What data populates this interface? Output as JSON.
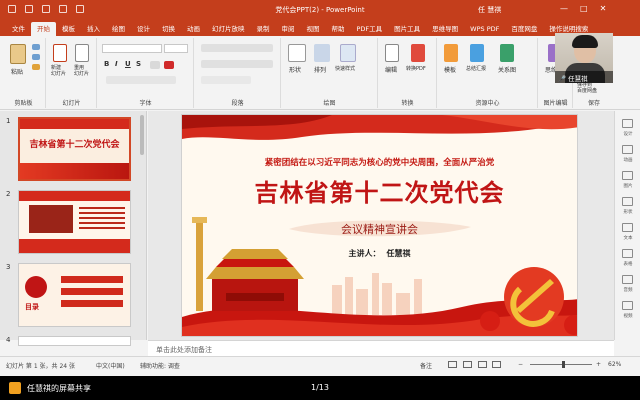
{
  "titlebar": {
    "title": "党代会PPT(2)  -  PowerPoint",
    "user_name": "任 慧祺",
    "min_icon": "minimize-icon",
    "max_icon": "maximize-icon",
    "close_icon": "close-icon"
  },
  "ribbon_tabs": [
    "文件",
    "开始",
    "模板",
    "插入",
    "绘图",
    "设计",
    "切换",
    "动画",
    "幻灯片放映",
    "录制",
    "审阅",
    "视图",
    "帮助",
    "PDF工具",
    "图片工具",
    "思维导图",
    "WPS PDF",
    "百度网盘",
    "操作说明搜索"
  ],
  "active_tab": "开始",
  "ribbon": {
    "paste_label": "粘贴",
    "new_slide_label": "新建\n幻灯片",
    "reuse_label": "重用\n幻灯片",
    "shapes_label": "形状",
    "arrange_label": "排列",
    "quick_styles_label": "快速样式",
    "edit_label": "编辑",
    "to_pdf_label": "转换PDF",
    "template_label": "模板",
    "summary_label": "总结汇报",
    "relation_label": "关系图",
    "mindmap_label": "思维导",
    "baidu_save_label": "保存到\n百度网盘",
    "groups": {
      "clipboard": "剪贴板",
      "slides": "幻灯片",
      "font": "字体",
      "paragraph": "段落",
      "drawing": "绘图",
      "convert": "转换",
      "resource": "资源中心",
      "image_edit": "图片编辑",
      "save": "保存"
    }
  },
  "thumbnails": [
    {
      "num": "1",
      "title": "吉林省第十二次党代会",
      "selected": true
    },
    {
      "num": "2",
      "title": "",
      "selected": false
    },
    {
      "num": "3",
      "title": "目录",
      "selected": false
    },
    {
      "num": "4",
      "title": "",
      "selected": false
    }
  ],
  "slide": {
    "subtitle": "紧密团结在以习近平同志为核心的党中央周围，全面从严治党",
    "title": "吉林省第十二次党代会",
    "caption": "会议精神宣讲会",
    "speaker_label": "主讲人：",
    "speaker_name": "任慧祺"
  },
  "notes_placeholder": "单击此处添加备注",
  "statusbar": {
    "slide_count": "幻灯片 第 1 张，共 24 张",
    "language": "中文(中国)",
    "accessibility": "辅助功能: 调查",
    "notes_btn": "备注",
    "zoom": "62%"
  },
  "right_pane": [
    "设计",
    "动画",
    "图片",
    "形状",
    "文本",
    "表格",
    "音频",
    "视频"
  ],
  "webcam": {
    "name": "任慧祺"
  },
  "share_bar": {
    "label": "任慧祺的屏幕共享",
    "page": "1/13"
  },
  "colors": {
    "ribbon_red": "#c43e1c",
    "slide_red": "#c01515"
  }
}
